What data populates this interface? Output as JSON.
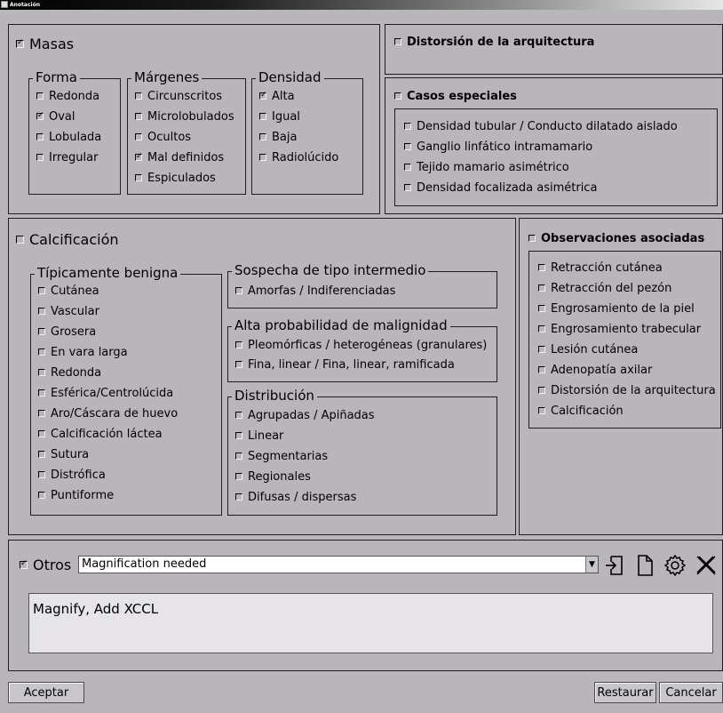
{
  "window": {
    "title": "Anotación"
  },
  "masas": {
    "label": "Masas",
    "checked": true,
    "forma": {
      "legend": "Forma",
      "items": [
        {
          "label": "Redonda",
          "checked": false
        },
        {
          "label": "Oval",
          "checked": true
        },
        {
          "label": "Lobulada",
          "checked": false
        },
        {
          "label": "Irregular",
          "checked": false
        }
      ]
    },
    "margenes": {
      "legend": "Márgenes",
      "items": [
        {
          "label": "Circunscritos",
          "checked": false
        },
        {
          "label": "Microlobulados",
          "checked": false
        },
        {
          "label": "Ocultos",
          "checked": false
        },
        {
          "label": "Mal definidos",
          "checked": true
        },
        {
          "label": "Espiculados",
          "checked": false
        }
      ]
    },
    "densidad": {
      "legend": "Densidad",
      "items": [
        {
          "label": "Alta",
          "checked": true
        },
        {
          "label": "Igual",
          "checked": false
        },
        {
          "label": "Baja",
          "checked": false
        },
        {
          "label": "Radiolúcido",
          "checked": false
        }
      ]
    }
  },
  "distorsion": {
    "label": "Distorsión de la arquitectura",
    "checked": false
  },
  "casos": {
    "label": "Casos especiales",
    "checked": false,
    "items": [
      {
        "label": "Densidad tubular / Conducto dilatado aislado",
        "checked": false
      },
      {
        "label": "Ganglio linfático intramamario",
        "checked": false
      },
      {
        "label": "Tejido mamario asimétrico",
        "checked": false
      },
      {
        "label": "Densidad focalizada asimétrica",
        "checked": false
      }
    ]
  },
  "calcificacion": {
    "label": "Calcificación",
    "checked": false,
    "benigna": {
      "legend": "Típicamente benigna",
      "items": [
        {
          "label": "Cutánea",
          "checked": false
        },
        {
          "label": "Vascular",
          "checked": false
        },
        {
          "label": "Grosera",
          "checked": false
        },
        {
          "label": "En vara larga",
          "checked": false
        },
        {
          "label": "Redonda",
          "checked": false
        },
        {
          "label": "Esférica/Centrolúcida",
          "checked": false
        },
        {
          "label": "Aro/Cáscara de huevo",
          "checked": false
        },
        {
          "label": "Calcificación láctea",
          "checked": false
        },
        {
          "label": "Sutura",
          "checked": false
        },
        {
          "label": "Distrófica",
          "checked": false
        },
        {
          "label": "Puntiforme",
          "checked": false
        }
      ]
    },
    "intermedio": {
      "legend": "Sospecha de tipo intermedio",
      "items": [
        {
          "label": "Amorfas / Indiferenciadas",
          "checked": false
        }
      ]
    },
    "malignidad": {
      "legend": "Alta probabilidad de malignidad",
      "items": [
        {
          "label": "Pleomórficas / heterogéneas (granulares)",
          "checked": false
        },
        {
          "label": "Fina, linear / Fina, linear, ramificada",
          "checked": false
        }
      ]
    },
    "distribucion": {
      "legend": "Distribución",
      "items": [
        {
          "label": "Agrupadas / Apiñadas",
          "checked": false
        },
        {
          "label": "Linear",
          "checked": false
        },
        {
          "label": "Segmentarias",
          "checked": false
        },
        {
          "label": "Regionales",
          "checked": false
        },
        {
          "label": "Difusas / dispersas",
          "checked": false
        }
      ]
    }
  },
  "observaciones": {
    "label": "Observaciones asociadas",
    "checked": false,
    "items": [
      {
        "label": "Retracción cutánea",
        "checked": false
      },
      {
        "label": "Retracción del pezón",
        "checked": false
      },
      {
        "label": "Engrosamiento de la piel",
        "checked": false
      },
      {
        "label": "Engrosamiento trabecular",
        "checked": false
      },
      {
        "label": "Lesión cutánea",
        "checked": false
      },
      {
        "label": "Adenopatía axilar",
        "checked": false
      },
      {
        "label": "Distorsión de la arquitectura",
        "checked": false
      },
      {
        "label": "Calcificación",
        "checked": false
      }
    ]
  },
  "otros": {
    "label": "Otros",
    "checked": true,
    "selected": "Magnification needed",
    "notes": "Magnify, Add XCCL",
    "icons": [
      "import-icon",
      "new-document-icon",
      "settings-gear-icon",
      "close-icon"
    ]
  },
  "buttons": {
    "accept": "Aceptar",
    "restore": "Restaurar",
    "cancel": "Cancelar"
  }
}
